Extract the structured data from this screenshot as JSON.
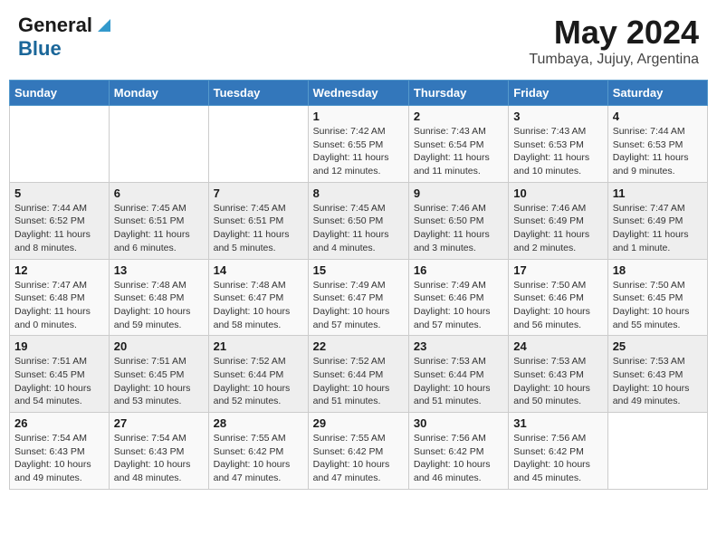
{
  "header": {
    "logo_general": "General",
    "logo_blue": "Blue",
    "month_year": "May 2024",
    "location": "Tumbaya, Jujuy, Argentina"
  },
  "calendar": {
    "days_of_week": [
      "Sunday",
      "Monday",
      "Tuesday",
      "Wednesday",
      "Thursday",
      "Friday",
      "Saturday"
    ],
    "weeks": [
      [
        {
          "day": "",
          "info": ""
        },
        {
          "day": "",
          "info": ""
        },
        {
          "day": "",
          "info": ""
        },
        {
          "day": "1",
          "info": "Sunrise: 7:42 AM\nSunset: 6:55 PM\nDaylight: 11 hours\nand 12 minutes."
        },
        {
          "day": "2",
          "info": "Sunrise: 7:43 AM\nSunset: 6:54 PM\nDaylight: 11 hours\nand 11 minutes."
        },
        {
          "day": "3",
          "info": "Sunrise: 7:43 AM\nSunset: 6:53 PM\nDaylight: 11 hours\nand 10 minutes."
        },
        {
          "day": "4",
          "info": "Sunrise: 7:44 AM\nSunset: 6:53 PM\nDaylight: 11 hours\nand 9 minutes."
        }
      ],
      [
        {
          "day": "5",
          "info": "Sunrise: 7:44 AM\nSunset: 6:52 PM\nDaylight: 11 hours\nand 8 minutes."
        },
        {
          "day": "6",
          "info": "Sunrise: 7:45 AM\nSunset: 6:51 PM\nDaylight: 11 hours\nand 6 minutes."
        },
        {
          "day": "7",
          "info": "Sunrise: 7:45 AM\nSunset: 6:51 PM\nDaylight: 11 hours\nand 5 minutes."
        },
        {
          "day": "8",
          "info": "Sunrise: 7:45 AM\nSunset: 6:50 PM\nDaylight: 11 hours\nand 4 minutes."
        },
        {
          "day": "9",
          "info": "Sunrise: 7:46 AM\nSunset: 6:50 PM\nDaylight: 11 hours\nand 3 minutes."
        },
        {
          "day": "10",
          "info": "Sunrise: 7:46 AM\nSunset: 6:49 PM\nDaylight: 11 hours\nand 2 minutes."
        },
        {
          "day": "11",
          "info": "Sunrise: 7:47 AM\nSunset: 6:49 PM\nDaylight: 11 hours\nand 1 minute."
        }
      ],
      [
        {
          "day": "12",
          "info": "Sunrise: 7:47 AM\nSunset: 6:48 PM\nDaylight: 11 hours\nand 0 minutes."
        },
        {
          "day": "13",
          "info": "Sunrise: 7:48 AM\nSunset: 6:48 PM\nDaylight: 10 hours\nand 59 minutes."
        },
        {
          "day": "14",
          "info": "Sunrise: 7:48 AM\nSunset: 6:47 PM\nDaylight: 10 hours\nand 58 minutes."
        },
        {
          "day": "15",
          "info": "Sunrise: 7:49 AM\nSunset: 6:47 PM\nDaylight: 10 hours\nand 57 minutes."
        },
        {
          "day": "16",
          "info": "Sunrise: 7:49 AM\nSunset: 6:46 PM\nDaylight: 10 hours\nand 57 minutes."
        },
        {
          "day": "17",
          "info": "Sunrise: 7:50 AM\nSunset: 6:46 PM\nDaylight: 10 hours\nand 56 minutes."
        },
        {
          "day": "18",
          "info": "Sunrise: 7:50 AM\nSunset: 6:45 PM\nDaylight: 10 hours\nand 55 minutes."
        }
      ],
      [
        {
          "day": "19",
          "info": "Sunrise: 7:51 AM\nSunset: 6:45 PM\nDaylight: 10 hours\nand 54 minutes."
        },
        {
          "day": "20",
          "info": "Sunrise: 7:51 AM\nSunset: 6:45 PM\nDaylight: 10 hours\nand 53 minutes."
        },
        {
          "day": "21",
          "info": "Sunrise: 7:52 AM\nSunset: 6:44 PM\nDaylight: 10 hours\nand 52 minutes."
        },
        {
          "day": "22",
          "info": "Sunrise: 7:52 AM\nSunset: 6:44 PM\nDaylight: 10 hours\nand 51 minutes."
        },
        {
          "day": "23",
          "info": "Sunrise: 7:53 AM\nSunset: 6:44 PM\nDaylight: 10 hours\nand 51 minutes."
        },
        {
          "day": "24",
          "info": "Sunrise: 7:53 AM\nSunset: 6:43 PM\nDaylight: 10 hours\nand 50 minutes."
        },
        {
          "day": "25",
          "info": "Sunrise: 7:53 AM\nSunset: 6:43 PM\nDaylight: 10 hours\nand 49 minutes."
        }
      ],
      [
        {
          "day": "26",
          "info": "Sunrise: 7:54 AM\nSunset: 6:43 PM\nDaylight: 10 hours\nand 49 minutes."
        },
        {
          "day": "27",
          "info": "Sunrise: 7:54 AM\nSunset: 6:43 PM\nDaylight: 10 hours\nand 48 minutes."
        },
        {
          "day": "28",
          "info": "Sunrise: 7:55 AM\nSunset: 6:42 PM\nDaylight: 10 hours\nand 47 minutes."
        },
        {
          "day": "29",
          "info": "Sunrise: 7:55 AM\nSunset: 6:42 PM\nDaylight: 10 hours\nand 47 minutes."
        },
        {
          "day": "30",
          "info": "Sunrise: 7:56 AM\nSunset: 6:42 PM\nDaylight: 10 hours\nand 46 minutes."
        },
        {
          "day": "31",
          "info": "Sunrise: 7:56 AM\nSunset: 6:42 PM\nDaylight: 10 hours\nand 45 minutes."
        },
        {
          "day": "",
          "info": ""
        }
      ]
    ]
  }
}
